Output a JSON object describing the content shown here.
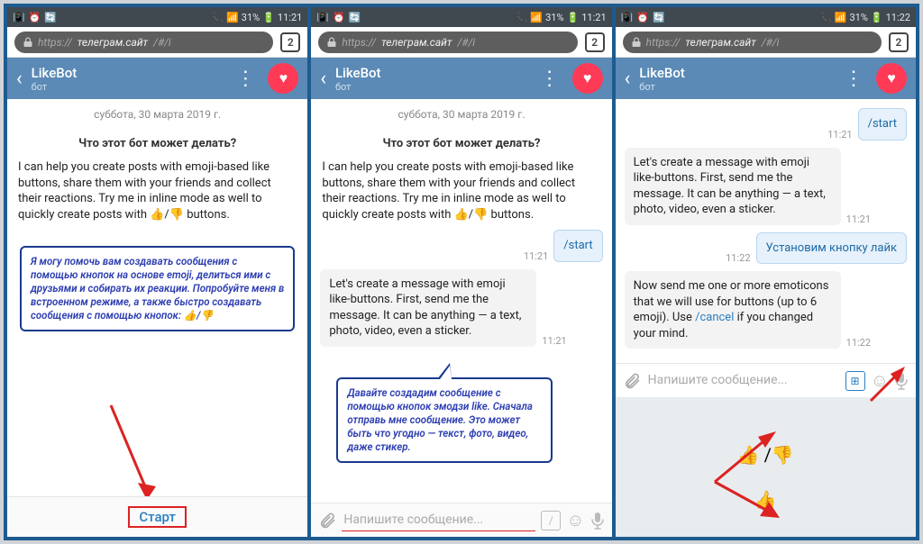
{
  "status": {
    "battery": "31%",
    "times": [
      "11:21",
      "11:21",
      "11:22"
    ]
  },
  "browser": {
    "scheme": "https://",
    "host": "телеграм.сайт",
    "path": "/#/i",
    "tab_count": "2"
  },
  "header": {
    "title": "LikeBot",
    "subtitle": "бот"
  },
  "panel1": {
    "date": "суббота, 30 марта 2019 г.",
    "heading": "Что этот бот может делать?",
    "intro": "I can help you create posts with emoji-based like buttons, share them with your friends and collect their reactions. Try me in inline mode as well to quickly create posts with 👍/👎 buttons.",
    "translation": "Я могу помочь вам создавать сообщения с помощью кнопок на основе emoji, делиться ими с друзьями и собирать их реакции. Попробуйте меня в встроенном режиме, а также быстро создавать сообщения с помощью кнопок: 👍/👎",
    "start_label": "Старт"
  },
  "panel2": {
    "date": "суббота, 30 марта 2019 г.",
    "heading": "Что этот бот может делать?",
    "intro": "I can help you create posts with emoji-based like buttons, share them with your friends and collect their reactions. Try me in inline mode as well to quickly create posts with 👍/👎 buttons.",
    "out1": {
      "text": "/start",
      "time": "11:21"
    },
    "in1": {
      "text": "Let's create a message with emoji like-buttons. First, send me the message. It can be anything — a text, photo, video, even a sticker.",
      "time": "11:21"
    },
    "translation": "Давайте создадим сообщение с помощью кнопок эмодзи like. Сначала отправь мне сообщение. Это может быть что угодно — текст, фото, видео, даже стикер.",
    "input_placeholder": "Напишите сообщение..."
  },
  "panel3": {
    "out1": {
      "text": "/start",
      "time": "11:21"
    },
    "in1": {
      "text": "Let's create a message with emoji like-buttons. First, send me the message. It can be anything — a text, photo, video, even a sticker.",
      "time": "11:21"
    },
    "out2": {
      "text": "Установим кнопку лайк",
      "time": "11:22"
    },
    "in2": {
      "text_pre": "Now send me one or more emoticons that we will use for buttons (up to 6 emoji). Use ",
      "cancel": "/cancel",
      "text_post": " if you changed your mind.",
      "time": "11:22"
    },
    "input_placeholder": "Напишите сообщение...",
    "sticker_line1": "👍 /👎",
    "sticker_line2": "👍"
  }
}
